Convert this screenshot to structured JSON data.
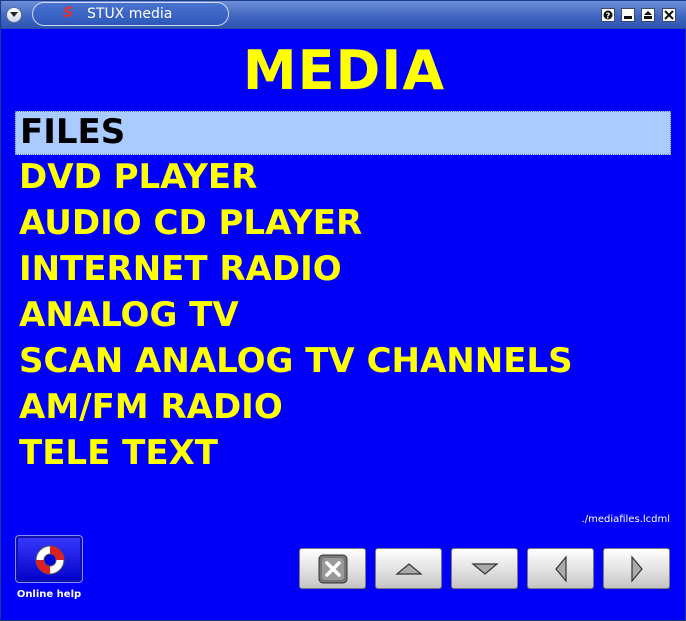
{
  "window": {
    "title": "STUX media",
    "logo": "S"
  },
  "title_bar": {
    "buttons": [
      "help-icon",
      "minimize-icon",
      "shade-icon",
      "close-icon"
    ]
  },
  "page": {
    "heading": "MEDIA",
    "menu": [
      {
        "label": "FILES",
        "selected": true
      },
      {
        "label": "DVD PLAYER",
        "selected": false
      },
      {
        "label": "AUDIO CD PLAYER",
        "selected": false
      },
      {
        "label": "INTERNET RADIO",
        "selected": false
      },
      {
        "label": "ANALOG TV",
        "selected": false
      },
      {
        "label": "SCAN ANALOG TV CHANNELS",
        "selected": false
      },
      {
        "label": "AM/FM RADIO",
        "selected": false
      },
      {
        "label": "TELE TEXT",
        "selected": false
      }
    ],
    "file_path": "./mediafiles.lcdml"
  },
  "help": {
    "label": "Online help",
    "icon": "lifebuoy-icon"
  },
  "nav": {
    "buttons": [
      "close-x-icon",
      "arrow-up-icon",
      "arrow-down-icon",
      "arrow-left-icon",
      "arrow-right-icon"
    ]
  },
  "colors": {
    "background": "#0000f8",
    "text": "#ffff00",
    "selection": "#aacbff"
  }
}
